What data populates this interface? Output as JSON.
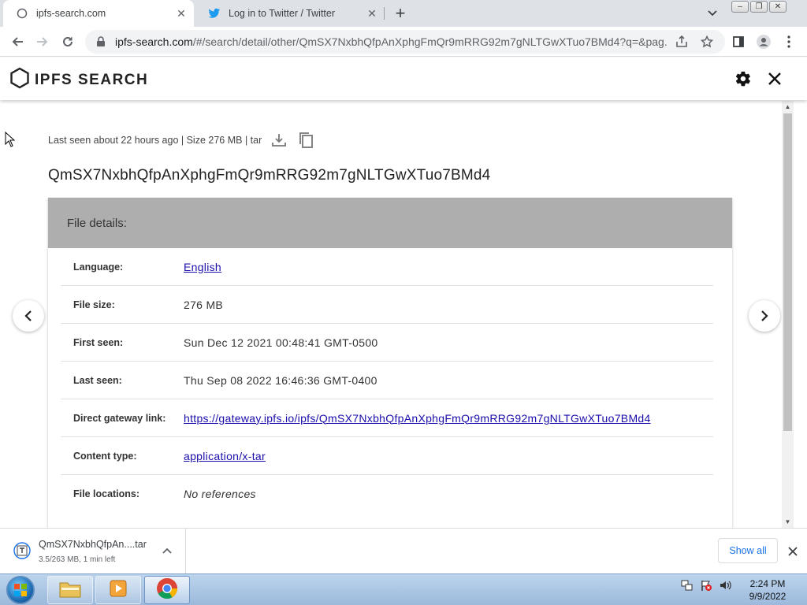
{
  "browser": {
    "tabs": [
      {
        "title": "ipfs-search.com",
        "active": true
      },
      {
        "title": "Log in to Twitter / Twitter",
        "active": false
      }
    ],
    "url_host": "ipfs-search.com",
    "url_rest": "/#/search/detail/other/QmSX7NxbhQfpAnXphgFmQr9mRRG92m7gNLTGwXTuo7BMd4?q=&pag..."
  },
  "site": {
    "brand": "IPFS SEARCH"
  },
  "detail": {
    "meta": "Last seen about 22 hours ago | Size 276 MB | tar",
    "hash": "QmSX7NxbhQfpAnXphgFmQr9mRRG92m7gNLTGwXTuo7BMd4",
    "card_title": "File details:",
    "rows": [
      {
        "label": "Language:",
        "value": "English"
      },
      {
        "label": "File size:",
        "value": "276 MB"
      },
      {
        "label": "First seen:",
        "value": "Sun Dec 12 2021 00:48:41 GMT-0500"
      },
      {
        "label": "Last seen:",
        "value": "Thu Sep 08 2022 16:46:36 GMT-0400"
      },
      {
        "label": "Direct gateway link:",
        "value": "https://gateway.ipfs.io/ipfs/QmSX7NxbhQfpAnXphgFmQr9mRRG92m7gNLTGwXTuo7BMd4"
      },
      {
        "label": "Content type:",
        "value": "application/x-tar"
      },
      {
        "label": "File locations:",
        "value": "No references"
      }
    ]
  },
  "downloads": {
    "item_name": "QmSX7NxbhQfpAn....tar",
    "item_status": "3.5/263 MB, 1 min left",
    "show_all": "Show all"
  },
  "taskbar": {
    "time": "2:24 PM",
    "date": "9/9/2022"
  }
}
